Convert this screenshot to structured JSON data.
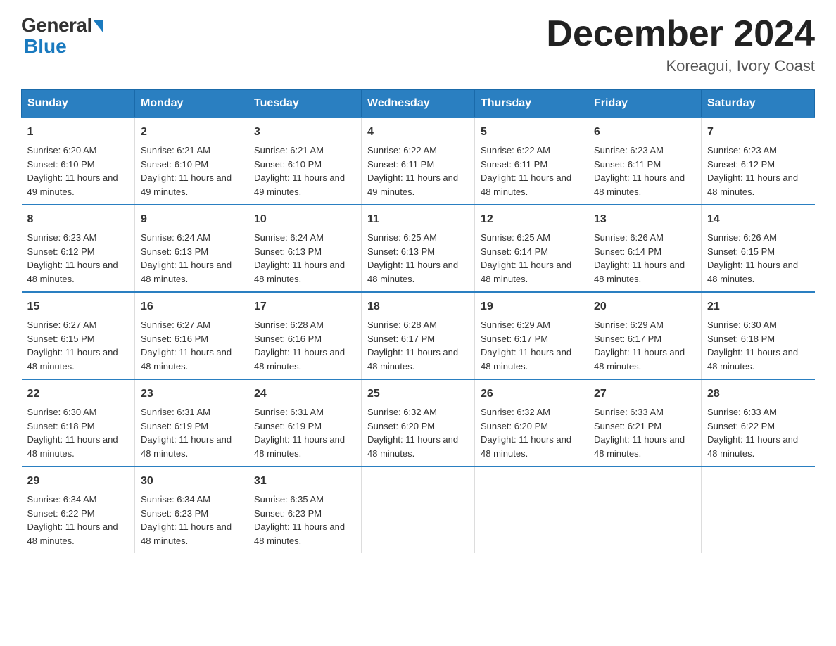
{
  "logo": {
    "general": "General",
    "blue": "Blue",
    "tagline": "Blue"
  },
  "title": "December 2024",
  "location": "Koreagui, Ivory Coast",
  "headers": [
    "Sunday",
    "Monday",
    "Tuesday",
    "Wednesday",
    "Thursday",
    "Friday",
    "Saturday"
  ],
  "weeks": [
    [
      {
        "day": "1",
        "sunrise": "6:20 AM",
        "sunset": "6:10 PM",
        "daylight": "11 hours and 49 minutes."
      },
      {
        "day": "2",
        "sunrise": "6:21 AM",
        "sunset": "6:10 PM",
        "daylight": "11 hours and 49 minutes."
      },
      {
        "day": "3",
        "sunrise": "6:21 AM",
        "sunset": "6:10 PM",
        "daylight": "11 hours and 49 minutes."
      },
      {
        "day": "4",
        "sunrise": "6:22 AM",
        "sunset": "6:11 PM",
        "daylight": "11 hours and 49 minutes."
      },
      {
        "day": "5",
        "sunrise": "6:22 AM",
        "sunset": "6:11 PM",
        "daylight": "11 hours and 48 minutes."
      },
      {
        "day": "6",
        "sunrise": "6:23 AM",
        "sunset": "6:11 PM",
        "daylight": "11 hours and 48 minutes."
      },
      {
        "day": "7",
        "sunrise": "6:23 AM",
        "sunset": "6:12 PM",
        "daylight": "11 hours and 48 minutes."
      }
    ],
    [
      {
        "day": "8",
        "sunrise": "6:23 AM",
        "sunset": "6:12 PM",
        "daylight": "11 hours and 48 minutes."
      },
      {
        "day": "9",
        "sunrise": "6:24 AM",
        "sunset": "6:13 PM",
        "daylight": "11 hours and 48 minutes."
      },
      {
        "day": "10",
        "sunrise": "6:24 AM",
        "sunset": "6:13 PM",
        "daylight": "11 hours and 48 minutes."
      },
      {
        "day": "11",
        "sunrise": "6:25 AM",
        "sunset": "6:13 PM",
        "daylight": "11 hours and 48 minutes."
      },
      {
        "day": "12",
        "sunrise": "6:25 AM",
        "sunset": "6:14 PM",
        "daylight": "11 hours and 48 minutes."
      },
      {
        "day": "13",
        "sunrise": "6:26 AM",
        "sunset": "6:14 PM",
        "daylight": "11 hours and 48 minutes."
      },
      {
        "day": "14",
        "sunrise": "6:26 AM",
        "sunset": "6:15 PM",
        "daylight": "11 hours and 48 minutes."
      }
    ],
    [
      {
        "day": "15",
        "sunrise": "6:27 AM",
        "sunset": "6:15 PM",
        "daylight": "11 hours and 48 minutes."
      },
      {
        "day": "16",
        "sunrise": "6:27 AM",
        "sunset": "6:16 PM",
        "daylight": "11 hours and 48 minutes."
      },
      {
        "day": "17",
        "sunrise": "6:28 AM",
        "sunset": "6:16 PM",
        "daylight": "11 hours and 48 minutes."
      },
      {
        "day": "18",
        "sunrise": "6:28 AM",
        "sunset": "6:17 PM",
        "daylight": "11 hours and 48 minutes."
      },
      {
        "day": "19",
        "sunrise": "6:29 AM",
        "sunset": "6:17 PM",
        "daylight": "11 hours and 48 minutes."
      },
      {
        "day": "20",
        "sunrise": "6:29 AM",
        "sunset": "6:17 PM",
        "daylight": "11 hours and 48 minutes."
      },
      {
        "day": "21",
        "sunrise": "6:30 AM",
        "sunset": "6:18 PM",
        "daylight": "11 hours and 48 minutes."
      }
    ],
    [
      {
        "day": "22",
        "sunrise": "6:30 AM",
        "sunset": "6:18 PM",
        "daylight": "11 hours and 48 minutes."
      },
      {
        "day": "23",
        "sunrise": "6:31 AM",
        "sunset": "6:19 PM",
        "daylight": "11 hours and 48 minutes."
      },
      {
        "day": "24",
        "sunrise": "6:31 AM",
        "sunset": "6:19 PM",
        "daylight": "11 hours and 48 minutes."
      },
      {
        "day": "25",
        "sunrise": "6:32 AM",
        "sunset": "6:20 PM",
        "daylight": "11 hours and 48 minutes."
      },
      {
        "day": "26",
        "sunrise": "6:32 AM",
        "sunset": "6:20 PM",
        "daylight": "11 hours and 48 minutes."
      },
      {
        "day": "27",
        "sunrise": "6:33 AM",
        "sunset": "6:21 PM",
        "daylight": "11 hours and 48 minutes."
      },
      {
        "day": "28",
        "sunrise": "6:33 AM",
        "sunset": "6:22 PM",
        "daylight": "11 hours and 48 minutes."
      }
    ],
    [
      {
        "day": "29",
        "sunrise": "6:34 AM",
        "sunset": "6:22 PM",
        "daylight": "11 hours and 48 minutes."
      },
      {
        "day": "30",
        "sunrise": "6:34 AM",
        "sunset": "6:23 PM",
        "daylight": "11 hours and 48 minutes."
      },
      {
        "day": "31",
        "sunrise": "6:35 AM",
        "sunset": "6:23 PM",
        "daylight": "11 hours and 48 minutes."
      },
      null,
      null,
      null,
      null
    ]
  ],
  "cell_labels": {
    "sunrise": "Sunrise: ",
    "sunset": "Sunset: ",
    "daylight": "Daylight: "
  }
}
